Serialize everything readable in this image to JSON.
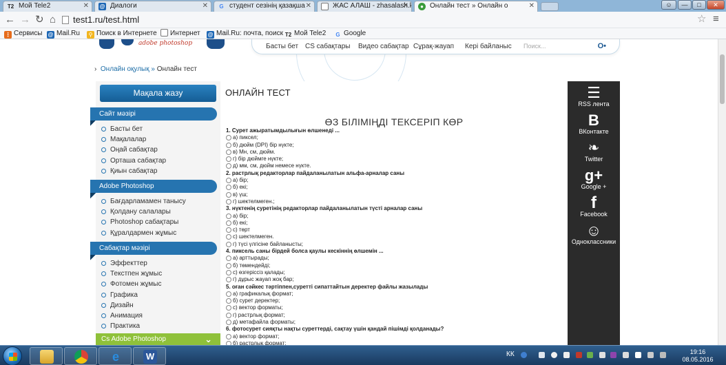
{
  "browser": {
    "tabs": [
      {
        "label": "Мой Tele2",
        "favicon": "tele2-icon",
        "active": false
      },
      {
        "label": "Диалоги",
        "favicon": "mailru-icon",
        "active": false
      },
      {
        "label": "студент сезінің қазақша",
        "favicon": "google-icon",
        "active": false
      },
      {
        "label": "ЖАС АЛАШ - zhasalash.k",
        "favicon": "page-icon",
        "active": false
      },
      {
        "label": "Онлайн тест » Онлайн о",
        "favicon": "site-icon",
        "active": true
      }
    ],
    "url": "test1.ru/test.html",
    "bookmarks": [
      {
        "label": "Сервисы",
        "icon": "apps-icon"
      },
      {
        "label": "Mail.Ru",
        "icon": "mailru-icon"
      },
      {
        "label": "Поиск в Интернете",
        "icon": "search-icon"
      },
      {
        "label": "Интернет",
        "icon": "page-icon"
      },
      {
        "label": "Mail.Ru: почта, поиск",
        "icon": "mailru-icon"
      },
      {
        "label": "Мой Tele2",
        "icon": "tele2-icon"
      },
      {
        "label": "Google",
        "icon": "google-icon"
      }
    ]
  },
  "site": {
    "logo_sub": "adobe photoshop",
    "nav": [
      "Басты бет",
      "CS сабақтары",
      "Видео сабақтар",
      "Сұрақ-жауап",
      "Кері байланыс"
    ],
    "search_placeholder": "Поиск...",
    "breadcrumb": {
      "link": "Онлайн оқулық",
      "separator": "»",
      "current": "Онлайн тест"
    },
    "write_button": "Мақала жазу",
    "sidebar": [
      {
        "title": "Сайт мәзірі",
        "items": [
          "Басты бет",
          "Мақалалар",
          "Оңай сабақтар",
          "Орташа сабақтар",
          "Қиын сабақтар"
        ]
      },
      {
        "title": "Adobe Photoshop",
        "items": [
          "Бағдарламамен танысу",
          "Қолдану салалары",
          "Photoshop сабақтары",
          "Құралдармен жұмыс"
        ]
      },
      {
        "title": "Сабақтар мәзірі",
        "items": [
          "Эффекттер",
          "Текстпен жұмыс",
          "Фотомен жұмыс",
          "Графика",
          "Дизайн",
          "Анимация",
          "Практика"
        ]
      }
    ],
    "green_bar": "Cs Adobe Photoshop",
    "main_title": "ОНЛАЙН ТЕСТ",
    "quiz_title": "ӨЗ БІЛІМІҢДІ ТЕКСЕРІП КӨР",
    "questions": [
      {
        "q": "1. Сурет ажыратымдылығын өлшенеді ...",
        "options": [
          "а) пиксел;",
          "б) дюйм (DPI) бір нүкте;",
          "в) Мн, см, дюйм.",
          "г) бір дюймге нүкте;",
          "д) мм, см, дюйм немесе нүкте."
        ]
      },
      {
        "q": "2. растрлық редакторлар пайдаланылатын альфа-арналар саны",
        "options": [
          "а) бір;",
          "б) екі;",
          "в) үш;",
          "г) шектелмеген.;"
        ]
      },
      {
        "q": "3. нүктенің суретінің редакторлар пайдаланылатын түсті арналар саны",
        "options": [
          "а) бір;",
          "б) екі;",
          "с) төрт",
          "с) шектелмеген.",
          "г) түсі үлгісіне байланысты;"
        ]
      },
      {
        "q": "4. пиксель саны бірдей болса қаулы кескіннің өлшемін ...",
        "options": [
          "а) арттырады;",
          "б) төмендейді;",
          "с) өзгеріссіз қалады;",
          "г) дұрыс жауап жоқ бар;"
        ]
      },
      {
        "q": "5. оған сәйкес тәртіппен,суретті сипаттайтын деректер файлы жазылады",
        "options": [
          "а) графикалық формат;",
          "б) сурет деректер;",
          "с) вектор форматы;",
          "г) растрлық формат;",
          "д) метафайла форматы;"
        ]
      },
      {
        "q": "6. фотосурет сияқты нақты суреттерді, сақтау үшін қандай пішімді қолданады?",
        "options": [
          "а) вектор формат;",
          "б) растрлық формат;"
        ]
      }
    ],
    "social": [
      {
        "label": "RSS лента",
        "icon": "rss-icon",
        "glyph": "☰"
      },
      {
        "label": "ВКонтакте",
        "icon": "vk-icon",
        "glyph": "B"
      },
      {
        "label": "Twitter",
        "icon": "twitter-icon",
        "glyph": "❧"
      },
      {
        "label": "Google +",
        "icon": "google-plus-icon",
        "glyph": "g+"
      },
      {
        "label": "Facebook",
        "icon": "facebook-icon",
        "glyph": "f"
      },
      {
        "label": "Одноклассники",
        "icon": "ok-icon",
        "glyph": "☺"
      }
    ]
  },
  "taskbar": {
    "lang": "КК",
    "time": "19:16",
    "date": "08.05.2016"
  },
  "colors": {
    "accent_blue": "#2674b0",
    "green_bar": "#8fc13a",
    "social_bg": "#2b2b2b"
  }
}
